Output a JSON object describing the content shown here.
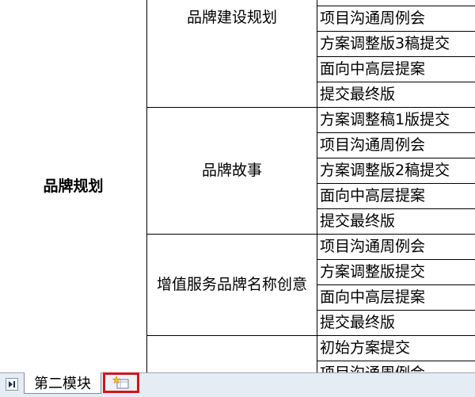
{
  "sheet": {
    "main_category": "品牌规划",
    "groups": [
      {
        "name": "品牌建设规划",
        "tasks": [
          "项目沟通周例会",
          "方案调整版3稿提交",
          "面向中高层提案",
          "提交最终版"
        ]
      },
      {
        "name": "品牌故事",
        "tasks": [
          "方案调整稿1版提交",
          "项目沟通周例会",
          "方案调整版2稿提交",
          "面向中高层提案",
          "提交最终版"
        ]
      },
      {
        "name": "增值服务品牌名称创意",
        "tasks": [
          "项目沟通周例会",
          "方案调整版提交",
          "面向中高层提案",
          "提交最终版"
        ]
      },
      {
        "name": "",
        "tasks": [
          "初始方案提交",
          "项目沟通周例会"
        ]
      }
    ]
  },
  "tabbar": {
    "nav_icon": "last-sheet-icon",
    "sheet_tab_label": "第二模块",
    "insert_icon": "insert-worksheet-icon",
    "highlight_color": "#d0161d"
  }
}
